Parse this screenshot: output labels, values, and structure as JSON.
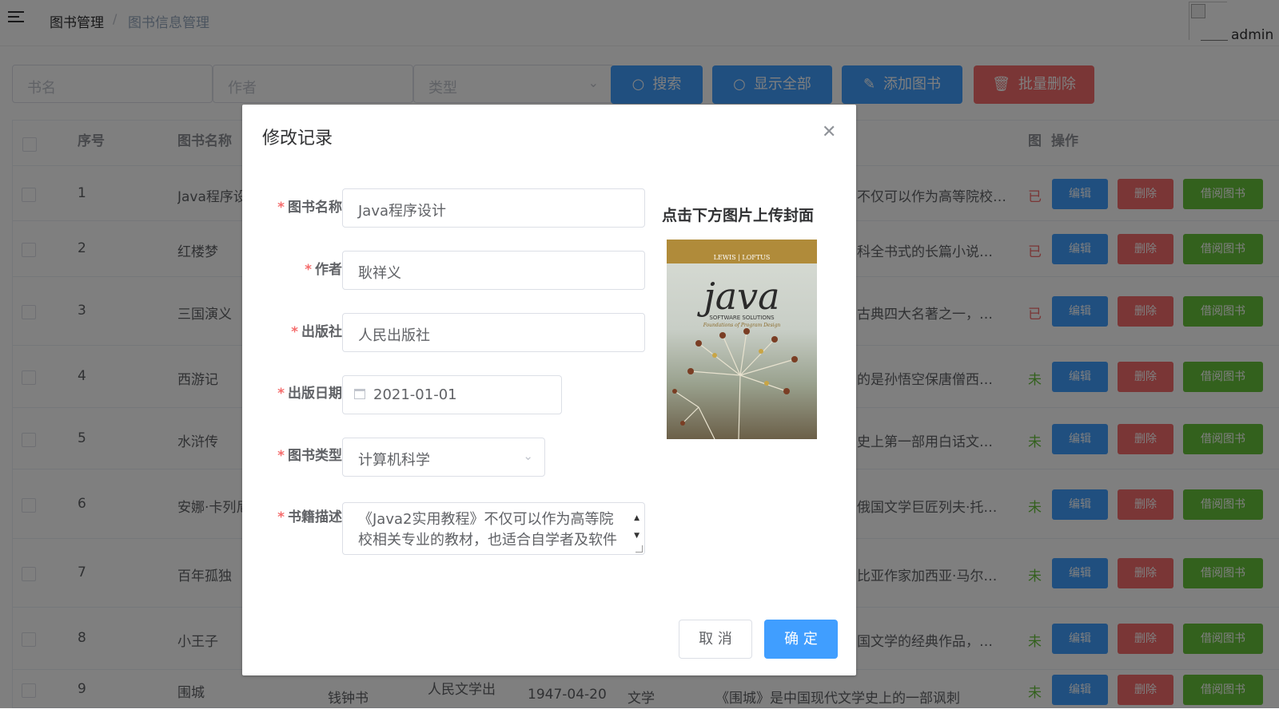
{
  "breadcrumb": {
    "root": "图书管理",
    "separator": "/",
    "current": "图书信息管理"
  },
  "header": {
    "username": "admin"
  },
  "toolbar": {
    "name_placeholder": "书名",
    "author_placeholder": "作者",
    "type_placeholder": "类型",
    "search_label": "搜索",
    "showall_label": "显示全部",
    "add_label": "添加图书",
    "bulkdel_label": "批量删除"
  },
  "table": {
    "headers": {
      "index": "序号",
      "name": "图书名称",
      "cover": "图",
      "actions": "操作"
    },
    "actions": {
      "edit": "编辑",
      "delete": "删除",
      "borrow": "借阅图书"
    },
    "rows": [
      {
        "index": "1",
        "name": "Java程序设",
        "desc": "不仅可以作为高等院校…",
        "status": "已"
      },
      {
        "index": "2",
        "name": "红楼梦",
        "desc": "科全书式的长篇小说…",
        "status": "已"
      },
      {
        "index": "3",
        "name": "三国演义",
        "desc": "古典四大名著之一，…",
        "status": "已"
      },
      {
        "index": "4",
        "name": "西游记",
        "desc": "的是孙悟空保唐僧西…",
        "status": "未"
      },
      {
        "index": "5",
        "name": "水浒传",
        "desc": "史上第一部用白话文…",
        "status": "未"
      },
      {
        "index": "6",
        "name": "安娜·卡列尼",
        "desc": "俄国文学巨匠列夫·托…",
        "status": "未"
      },
      {
        "index": "7",
        "name": "百年孤独",
        "desc": "比亚作家加西亚·马尔…",
        "status": "未"
      },
      {
        "index": "8",
        "name": "小王子",
        "desc": "国文学的经典作品，…",
        "status": "未"
      },
      {
        "index": "9",
        "name": "围城",
        "author": "钱钟书",
        "publisher": "人民文学出",
        "date": "1947-04-20",
        "type": "文学",
        "desc": "《围城》是中国现代文学史上的一部讽刺",
        "status": "未"
      }
    ]
  },
  "dialog": {
    "title": "修改记录",
    "close_icon": "close-icon",
    "required_mark": "*",
    "labels": {
      "name": "图书名称",
      "author": "作者",
      "publisher": "出版社",
      "date": "出版日期",
      "type": "图书类型",
      "desc": "书籍描述"
    },
    "values": {
      "name": "Java程序设计",
      "author": "耿祥义",
      "publisher": "人民出版社",
      "date": "2021-01-01",
      "type": "计算机科学",
      "desc": "《Java2实用教程》不仅可以作为高等院校相关专业的教材，也适合自学者及软件"
    },
    "upload_tip": "点击下方图片上传封面",
    "cover": {
      "authors": "LEWIS | LOFTUS",
      "title": "java",
      "subtitle": "SOFTWARE SOLUTIONS",
      "subtitle2": "Foundations of Program Design"
    },
    "cancel_label": "取 消",
    "ok_label": "确 定"
  },
  "colors": {
    "primary": "#409eff",
    "danger": "#f56c6c",
    "success": "#67c23a",
    "borrowed": "#f56c6c",
    "available": "#67c23a"
  }
}
